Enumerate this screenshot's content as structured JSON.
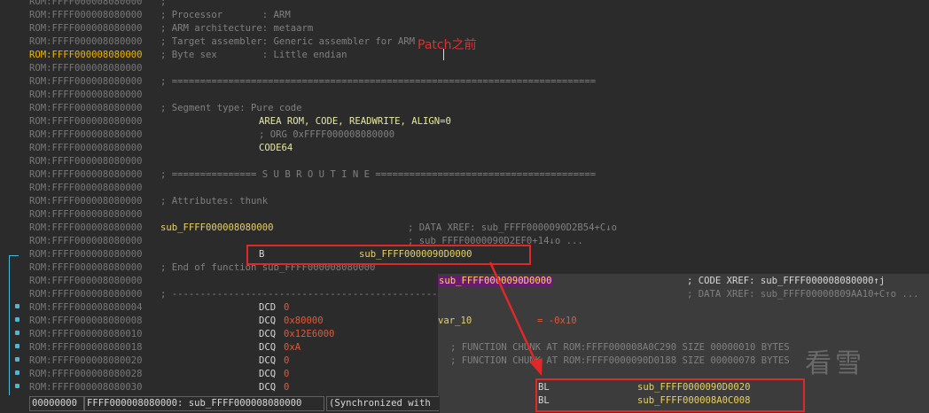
{
  "listing": {
    "rows": [
      {
        "addr": "ROM:FFFF000008080000",
        "text": ";"
      },
      {
        "addr": "ROM:FFFF000008080000",
        "text": "; Processor       : ARM"
      },
      {
        "addr": "ROM:FFFF000008080000",
        "text": "; ARM architecture: metaarm"
      },
      {
        "addr": "ROM:FFFF000008080000",
        "text": "; Target assembler: Generic assembler for ARM"
      },
      {
        "addr": "ROM:FFFF000008080000",
        "text": "; Byte sex        : Little endian"
      },
      {
        "addr": "ROM:FFFF000008080000",
        "text": ""
      },
      {
        "addr": "ROM:FFFF000008080000",
        "text": "; ==========================================================================="
      },
      {
        "addr": "ROM:FFFF000008080000",
        "text": ""
      },
      {
        "addr": "ROM:FFFF000008080000",
        "text": "; Segment type: Pure code"
      },
      {
        "addr": "ROM:FFFF000008080000",
        "text": "AREA ROM, CODE, READWRITE, ALIGN=0"
      },
      {
        "addr": "ROM:FFFF000008080000",
        "text": "; ORG 0xFFFF000008080000"
      },
      {
        "addr": "ROM:FFFF000008080000",
        "text": "CODE64"
      },
      {
        "addr": "ROM:FFFF000008080000",
        "text": ""
      },
      {
        "addr": "ROM:FFFF000008080000",
        "text": "; =============== S U B R O U T I N E ======================================="
      },
      {
        "addr": "ROM:FFFF000008080000",
        "text": ""
      },
      {
        "addr": "ROM:FFFF000008080000",
        "text": "; Attributes: thunk"
      },
      {
        "addr": "ROM:FFFF000008080000",
        "text": ""
      },
      {
        "addr": "ROM:FFFF000008080000",
        "label": "sub_FFFF000008080000",
        "comment": "; DATA XREF: sub_FFFF0000090D2B54+C↓o"
      },
      {
        "addr": "ROM:FFFF000008080000",
        "comment": "; sub_FFFF0000090D2EF0+14↓o ..."
      },
      {
        "addr": "ROM:FFFF000008080000",
        "mnem": "B",
        "operand": "sub_FFFF0000090D0000"
      },
      {
        "addr": "ROM:FFFF000008080000",
        "text": "; End of function sub_FFFF000008080000"
      },
      {
        "addr": "ROM:FFFF000008080000",
        "text": ""
      },
      {
        "addr": "ROM:FFFF000008080000",
        "text": "; ---------------------------------------------------------------------------"
      },
      {
        "addr": "ROM:FFFF000008080004",
        "mnem": "DCD",
        "num": "0"
      },
      {
        "addr": "ROM:FFFF000008080008",
        "mnem": "DCQ",
        "num": "0x80000"
      },
      {
        "addr": "ROM:FFFF000008080010",
        "mnem": "DCQ",
        "num": "0x12E6000"
      },
      {
        "addr": "ROM:FFFF000008080018",
        "mnem": "DCQ",
        "num": "0xA"
      },
      {
        "addr": "ROM:FFFF000008080020",
        "mnem": "DCQ",
        "num": "0"
      },
      {
        "addr": "ROM:FFFF000008080028",
        "mnem": "DCQ",
        "num": "0"
      },
      {
        "addr": "ROM:FFFF000008080030",
        "mnem": "DCQ",
        "num": "0"
      }
    ]
  },
  "annotation": "Patch之前",
  "popup": {
    "label": "sub_FFFF0000090D0000",
    "xref1": "; CODE XREF: sub_FFFF000008080000↑j",
    "xref2": "; DATA XREF: sub_FFFF00000809AA10+C↑o ...",
    "var": "var_10",
    "var_eq": "= -0x10",
    "chunk1": "; FUNCTION CHUNK AT ROM:FFFF000008A0C290 SIZE 00000010 BYTES",
    "chunk2": "; FUNCTION CHUNK AT ROM:FFFF0000090D0188 SIZE 00000078 BYTES",
    "bl1_mnem": "BL",
    "bl1_target": "sub_FFFF0000090D0020",
    "bl2_mnem": "BL",
    "bl2_target": "sub_FFFF000008A0C008"
  },
  "status": {
    "offset": "00000000",
    "location": "FFFF000008080000: sub_FFFF000008080000",
    "sync": "(Synchronized with"
  },
  "watermark": "看雪",
  "colors": {
    "highlight_box": "#e02828",
    "address": "#787878",
    "current_address": "#f0b400",
    "label": "#e8d260",
    "number": "#e05a3a",
    "flow_arrow": "#4ab8d8"
  }
}
